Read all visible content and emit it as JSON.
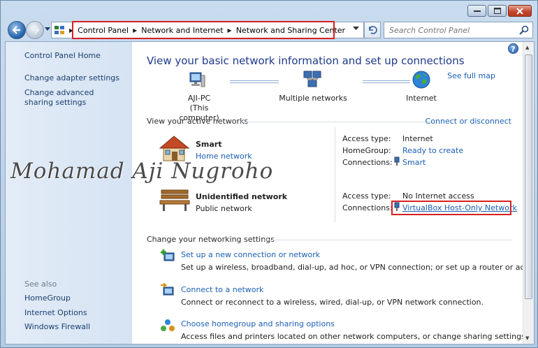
{
  "window": {
    "caption_buttons": [
      "minimize",
      "maximize",
      "close"
    ]
  },
  "address_bar": {
    "breadcrumbs": [
      "Control Panel",
      "Network and Internet",
      "Network and Sharing Center"
    ]
  },
  "search": {
    "placeholder": "Search Control Panel"
  },
  "sidebar": {
    "items": [
      {
        "label": "Control Panel Home"
      },
      {
        "label": "Change adapter settings"
      },
      {
        "label": "Change advanced sharing settings"
      }
    ],
    "see_also_label": "See also",
    "see_also": [
      {
        "label": "HomeGroup"
      },
      {
        "label": "Internet Options"
      },
      {
        "label": "Windows Firewall"
      }
    ]
  },
  "main": {
    "title": "View your basic network information and set up connections",
    "see_full_map": "See full map",
    "map": {
      "computer_name": "AJI-PC",
      "computer_sub": "(This computer)",
      "networks": "Multiple networks",
      "internet": "Internet"
    },
    "active_networks_label": "View your active networks",
    "connect_disconnect": "Connect or disconnect",
    "networks": [
      {
        "name": "Smart",
        "type": "Home network",
        "type_is_link": true,
        "access_type_label": "Access type:",
        "access_type": "Internet",
        "homegroup_label": "HomeGroup:",
        "homegroup": "Ready to create",
        "connections_label": "Connections:",
        "connection": "Smart"
      },
      {
        "name": "Unidentified network",
        "type": "Public network",
        "type_is_link": false,
        "access_type_label": "Access type:",
        "access_type": "No Internet access",
        "connections_label": "Connections:",
        "connection": "VirtualBox Host-Only Network"
      }
    ],
    "change_settings_label": "Change your networking settings",
    "tasks": [
      {
        "title": "Set up a new connection or network",
        "desc": "Set up a wireless, broadband, dial-up, ad hoc, or VPN connection; or set up a router or access point."
      },
      {
        "title": "Connect to a network",
        "desc": "Connect or reconnect to a wireless, wired, dial-up, or VPN network connection."
      },
      {
        "title": "Choose homegroup and sharing options",
        "desc": "Access files and printers located on other network computers, or change sharing settings."
      }
    ]
  },
  "watermark": "Mohamad Aji Nugroho",
  "colors": {
    "link": "#1a5fb4",
    "title": "#1e3a8a",
    "highlight": "#d8201f"
  }
}
